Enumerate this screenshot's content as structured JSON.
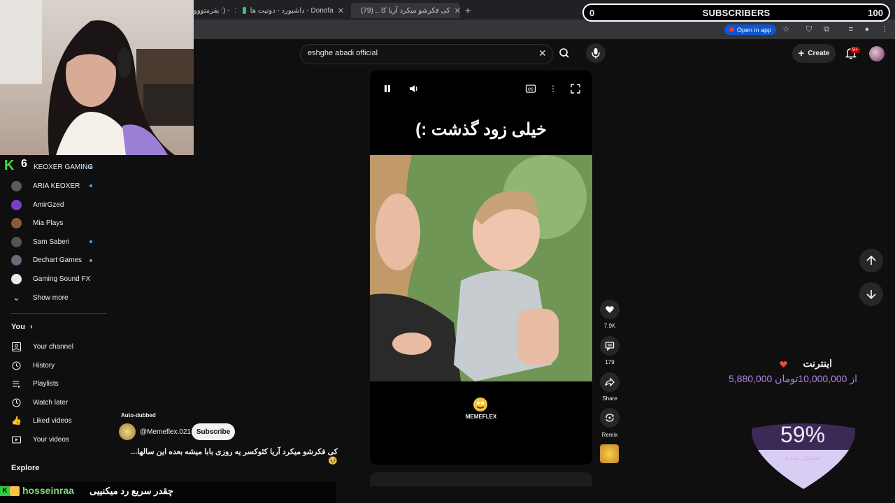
{
  "browser": {
    "tabs": [
      {
        "label": "بفرمتووو :) -"
      },
      {
        "label": "داشبورد - دونیت ها - Donofa"
      },
      {
        "label": "کی فکرشو میکرد آریا کا... (79)"
      }
    ],
    "open_in_app": "Open in app"
  },
  "subscribers_bar": {
    "left": "0",
    "label": "SUBSCRIBERS",
    "right": "100"
  },
  "search": {
    "query": "eshghe abadi official"
  },
  "header": {
    "create_label": "Create",
    "notif_badge": "9+"
  },
  "overlay": {
    "k6_logo": "K",
    "k6_number": "6"
  },
  "sidebar": {
    "subscriptions": [
      {
        "label": "KEOXER GAMING"
      },
      {
        "label": "ARIA KEOXER"
      },
      {
        "label": "AmirGzed"
      },
      {
        "label": "Mia Plays"
      },
      {
        "label": "Sam Saberi"
      },
      {
        "label": "Dechart Games"
      },
      {
        "label": "Gaming Sound FX"
      },
      {
        "label": "Show more"
      }
    ],
    "you_label": "You",
    "you_items": [
      {
        "label": "Your channel"
      },
      {
        "label": "History"
      },
      {
        "label": "Playlists"
      },
      {
        "label": "Watch later"
      },
      {
        "label": "Liked videos"
      },
      {
        "label": "Your videos"
      }
    ],
    "explore_label": "Explore"
  },
  "video": {
    "overlay_title": "خیلی زود گذشت :)",
    "logo_text": "MEMEFLEX"
  },
  "actions": {
    "likes": "7.9K",
    "comments": "179",
    "share": "Share",
    "remix": "Remix"
  },
  "channel": {
    "auto_dubbed": "Auto-dubbed",
    "name": "@Memeflex.021",
    "subscribe_label": "Subscribe",
    "description": "کی فکرشو میکرد آریا کئوکسر یه روزی بابا میشه بعده این سالها... 🥹"
  },
  "donation": {
    "title": "اینترنت",
    "amount": "5,880,000 از 10,000,000تومان",
    "progress_percent": 59,
    "percent_label": "59%",
    "sub_label": "تکمیل شده"
  },
  "chat": {
    "username": "hosseinraa",
    "message": "چقدر سریع رد میکنییی"
  }
}
